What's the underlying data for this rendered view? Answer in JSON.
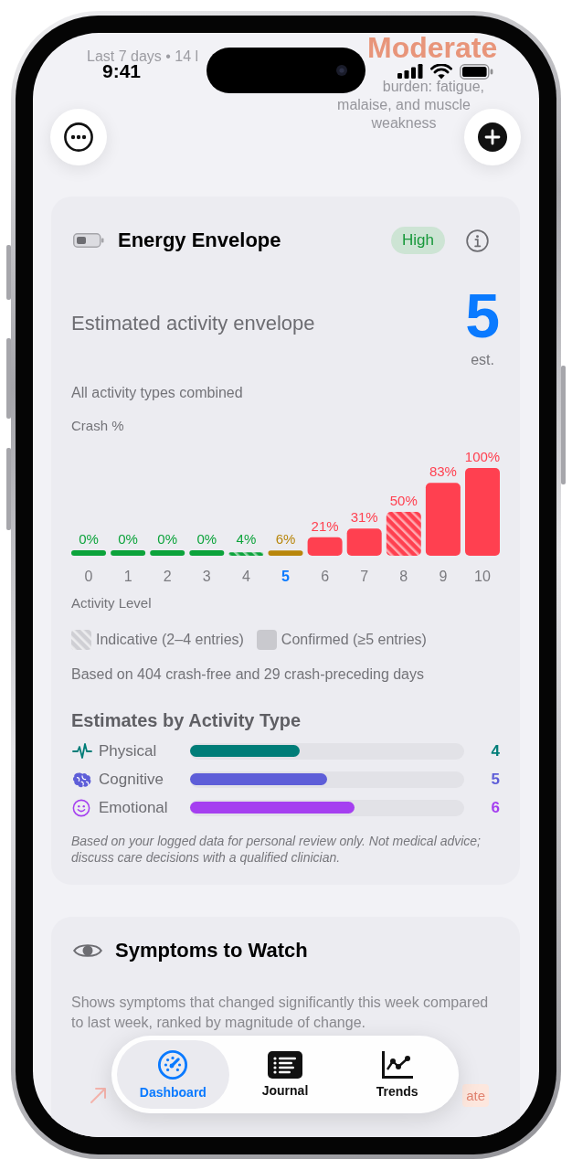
{
  "status_bar": {
    "time": "9:41"
  },
  "background_summary": {
    "period": "Last 7 days • 14 l",
    "severity": "Moderate",
    "description_lines": [
      "burden: fatigue,",
      "malaise, and muscle",
      "weakness"
    ]
  },
  "energy_card": {
    "title": "Energy Envelope",
    "confidence": "High",
    "estimate_label": "Estimated activity envelope",
    "estimate_value": "5",
    "estimate_unit": "est.",
    "scope": "All activity types combined",
    "chart": {
      "chart_data": {
        "type": "bar",
        "xlabel": "Activity Level",
        "ylabel": "Crash %",
        "categories": [
          "0",
          "1",
          "2",
          "3",
          "4",
          "5",
          "6",
          "7",
          "8",
          "9",
          "10"
        ],
        "values": [
          0,
          0,
          0,
          0,
          4,
          6,
          21,
          31,
          50,
          83,
          100
        ],
        "ylim": [
          0,
          100
        ],
        "value_labels": [
          "0%",
          "0%",
          "0%",
          "0%",
          "4%",
          "6%",
          "21%",
          "31%",
          "50%",
          "83%",
          "100%"
        ]
      },
      "bars": [
        {
          "color": "#0ca33b",
          "indicative": false,
          "selected": false
        },
        {
          "color": "#0ca33b",
          "indicative": false,
          "selected": false
        },
        {
          "color": "#0ca33b",
          "indicative": false,
          "selected": false
        },
        {
          "color": "#0ca33b",
          "indicative": false,
          "selected": false
        },
        {
          "color": "#0ca33b",
          "indicative": true,
          "selected": false
        },
        {
          "color": "#b8860b",
          "indicative": false,
          "selected": true
        },
        {
          "color": "#ff4050",
          "indicative": false,
          "selected": false
        },
        {
          "color": "#ff4050",
          "indicative": false,
          "selected": false
        },
        {
          "color": "#ff4050",
          "indicative": true,
          "selected": false
        },
        {
          "color": "#ff4050",
          "indicative": false,
          "selected": false
        },
        {
          "color": "#ff4050",
          "indicative": false,
          "selected": false
        }
      ]
    },
    "legend": [
      {
        "kind": "hatched",
        "label": "Indicative (2–4 entries)"
      },
      {
        "kind": "solid",
        "label": "Confirmed (≥5 entries)"
      }
    ],
    "basis": "Based on 404 crash-free and 29 crash-preceding days",
    "types_title": "Estimates by Activity Type",
    "activity_types": [
      {
        "label": "Physical",
        "value": "4",
        "level": 0.4,
        "color": "#007d78"
      },
      {
        "label": "Cognitive",
        "value": "5",
        "level": 0.5,
        "color": "#5e5ed8"
      },
      {
        "label": "Emotional",
        "value": "6",
        "level": 0.6,
        "color": "#a53ff0"
      }
    ],
    "disclaimer": "Based on your logged data for personal review only. Not medical advice; discuss care decisions with a qualified clinician."
  },
  "symptoms_card": {
    "title": "Symptoms to Watch",
    "description": "Shows symptoms that changed significantly this week compared to last week, ranked by magnitude of change.",
    "badge": "ate"
  },
  "tab_bar": [
    {
      "label": "Dashboard",
      "selected": true
    },
    {
      "label": "Journal",
      "selected": false
    },
    {
      "label": "Trends",
      "selected": false
    }
  ]
}
